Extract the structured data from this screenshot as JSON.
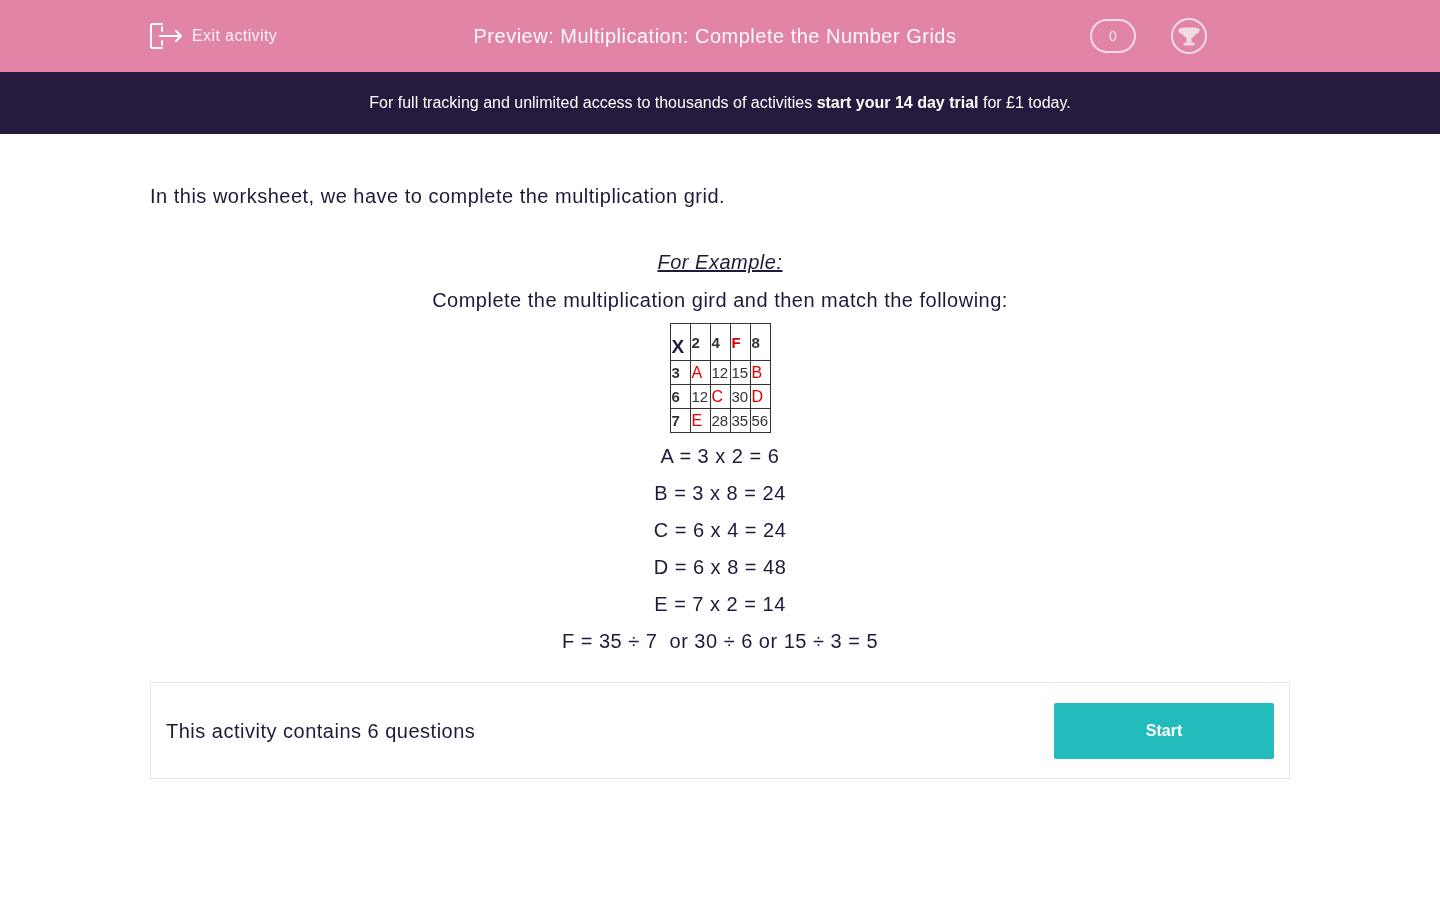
{
  "header": {
    "exit_label": "Exit activity",
    "title": "Preview: Multiplication: Complete the Number Grids",
    "score": "0"
  },
  "banner": "For full tracking and unlimited access to thousands of activities **start your 14 day trial** for £1 today.",
  "intro": "In this worksheet, we have to complete the multiplication grid.",
  "example_heading": "For Example:",
  "instruction": "Complete the multiplication gird and then match the following:",
  "grid": [
    [
      {
        "text": "X",
        "kind": "corner"
      },
      {
        "text": "2",
        "kind": "header"
      },
      {
        "text": "4",
        "kind": "header"
      },
      {
        "text": "F",
        "kind": "unknown_header"
      },
      {
        "text": "8",
        "kind": "header"
      }
    ],
    [
      {
        "text": "3",
        "kind": "header"
      },
      {
        "text": "A",
        "kind": "unknown"
      },
      {
        "text": "12",
        "kind": "value"
      },
      {
        "text": "15",
        "kind": "value"
      },
      {
        "text": "B",
        "kind": "unknown"
      }
    ],
    [
      {
        "text": "6",
        "kind": "header"
      },
      {
        "text": "12",
        "kind": "value"
      },
      {
        "text": "C",
        "kind": "unknown"
      },
      {
        "text": "30",
        "kind": "value"
      },
      {
        "text": "D",
        "kind": "unknown"
      }
    ],
    [
      {
        "text": "7",
        "kind": "header"
      },
      {
        "text": "E",
        "kind": "unknown"
      },
      {
        "text": "28",
        "kind": "value"
      },
      {
        "text": "35",
        "kind": "value"
      },
      {
        "text": "56",
        "kind": "value"
      }
    ]
  ],
  "answers": [
    "A = 3 x 2 = 6",
    "B = 3 x 8 = 24",
    "C = 6 x 4 = 24",
    "D = 6 x 8 = 48",
    "E = 7 x 2 = 14",
    "F = 35 ÷ 7  or 30 ÷ 6 or 15 ÷ 3 = 5"
  ],
  "footer": {
    "message": "This activity contains 6 questions",
    "button": "Start"
  }
}
